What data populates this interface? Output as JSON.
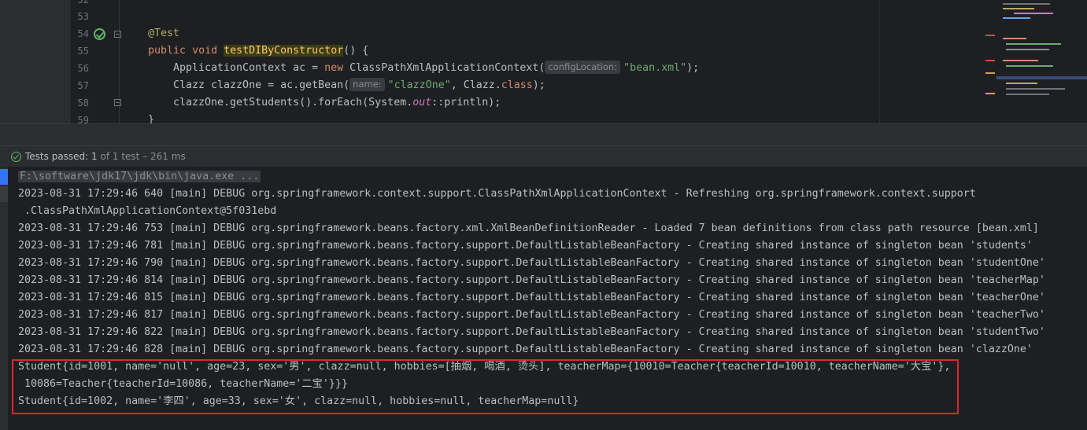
{
  "editor": {
    "line_numbers": [
      "52",
      "53",
      "54",
      "55",
      "56",
      "57",
      "58",
      "59"
    ],
    "annotation": "@Test",
    "line54": {
      "kw1": "public",
      "kw2": "void",
      "method": "testDIByConstructor",
      "rest": "() {"
    },
    "line55": {
      "type": "ApplicationContext ac = ",
      "kw": "new",
      "cls": " ClassPathXmlApplicationContext(",
      "hint": "configLocation:",
      "str": "\"bean.xml\"",
      "end": ");"
    },
    "line56": {
      "type": "Clazz clazzOne = ac.getBean(",
      "hint": "name:",
      "str": "\"clazzOne\"",
      "mid": ", Clazz.",
      "kw": "class",
      "end": ");"
    },
    "line57": {
      "a": "clazzOne.getStudents().forEach(System.",
      "out": "out",
      "b": "::println);"
    },
    "line58": {
      "brace": "}"
    }
  },
  "test_status": {
    "label": "Tests passed:",
    "passed": "1",
    "rest": "of 1 test",
    "duration": "– 261 ms"
  },
  "console": {
    "command": "F:\\software\\jdk17\\jdk\\bin\\java.exe ...",
    "lines": [
      "2023-08-31 17:29:46 640 [main] DEBUG org.springframework.context.support.ClassPathXmlApplicationContext - Refreshing org.springframework.context.support",
      " .ClassPathXmlApplicationContext@5f031ebd",
      "2023-08-31 17:29:46 753 [main] DEBUG org.springframework.beans.factory.xml.XmlBeanDefinitionReader - Loaded 7 bean definitions from class path resource [bean.xml]",
      "2023-08-31 17:29:46 781 [main] DEBUG org.springframework.beans.factory.support.DefaultListableBeanFactory - Creating shared instance of singleton bean 'students'",
      "2023-08-31 17:29:46 790 [main] DEBUG org.springframework.beans.factory.support.DefaultListableBeanFactory - Creating shared instance of singleton bean 'studentOne'",
      "2023-08-31 17:29:46 814 [main] DEBUG org.springframework.beans.factory.support.DefaultListableBeanFactory - Creating shared instance of singleton bean 'teacherMap'",
      "2023-08-31 17:29:46 815 [main] DEBUG org.springframework.beans.factory.support.DefaultListableBeanFactory - Creating shared instance of singleton bean 'teacherOne'",
      "2023-08-31 17:29:46 817 [main] DEBUG org.springframework.beans.factory.support.DefaultListableBeanFactory - Creating shared instance of singleton bean 'teacherTwo'",
      "2023-08-31 17:29:46 822 [main] DEBUG org.springframework.beans.factory.support.DefaultListableBeanFactory - Creating shared instance of singleton bean 'studentTwo'",
      "2023-08-31 17:29:46 828 [main] DEBUG org.springframework.beans.factory.support.DefaultListableBeanFactory - Creating shared instance of singleton bean 'clazzOne'",
      "Student{id=1001, name='null', age=23, sex='男', clazz=null, hobbies=[抽烟, 喝酒, 烫头], teacherMap={10010=Teacher{teacherId=10010, teacherName='大宝'},",
      " 10086=Teacher{teacherId=10086, teacherName='二宝'}}}",
      "Student{id=1002, name='李四', age=33, sex='女', clazz=null, hobbies=null, teacherMap=null}"
    ]
  }
}
